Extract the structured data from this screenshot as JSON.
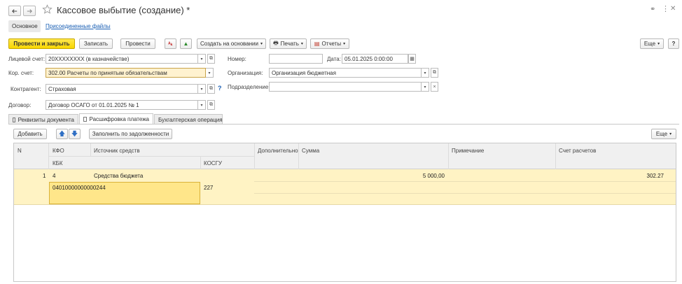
{
  "window": {
    "title": "Кассовое выбытие (создание) *",
    "nav_back_icon": "arrow-left-icon",
    "nav_forward_icon": "arrow-right-icon",
    "favorite_icon": "star-icon"
  },
  "sections": {
    "main": "Основное",
    "attached_files": "Присоединенные файлы"
  },
  "toolbar": {
    "post_and_close": "Провести и закрыть",
    "save": "Записать",
    "post": "Провести",
    "create_based_on": "Создать на основании",
    "print": "Печать",
    "reports": "Отчеты",
    "more": "Еще",
    "help": "?"
  },
  "form": {
    "personal_account_label": "Лицевой счет:",
    "personal_account_value": "20XXXXXXXX (в казначействе)",
    "number_label": "Номер:",
    "number_value": "",
    "date_label": "Дата:",
    "date_value": "05.01.2025  0:00:00",
    "corr_account_label": "Кор. счет:",
    "corr_account_value": "302.00 Расчеты по принятым обязательствам",
    "organization_label": "Организация:",
    "organization_value": "Организация бюджетная",
    "counterparty_label": "Контрагент:",
    "counterparty_value": "Страховая",
    "counterparty_help": "?",
    "subdivision_label": "Подразделение:",
    "subdivision_value": "",
    "contract_label": "Договор:",
    "contract_value": "Договор ОСАГО от 01.01.2025 № 1"
  },
  "tabs": [
    {
      "label": "Реквизиты документа"
    },
    {
      "label": "Расшифровка платежа"
    },
    {
      "label": "Бухгалтерская операция"
    }
  ],
  "table_toolbar": {
    "add": "Добавить",
    "fill_by_debt": "Заполнить по задолженности",
    "more": "Еще"
  },
  "table": {
    "headers": {
      "n": "N",
      "kfo": "КФО",
      "source": "Источник средств",
      "additional": "Дополнительно",
      "sum": "Сумма",
      "note": "Примечание",
      "account": "Счет расчетов",
      "kbk": "КБК",
      "kosgu": "КОСГУ"
    },
    "rows": [
      {
        "n": "1",
        "kfo": "4",
        "source": "Средства бюджета",
        "kbk": "04010000000000244",
        "kosgu": "227",
        "sum": "5 000,00",
        "account": "302.27"
      }
    ]
  },
  "colors": {
    "accent_yellow": "#f8d600",
    "row_highlight": "#fff3c4",
    "selected_cell": "#ffe68a"
  }
}
